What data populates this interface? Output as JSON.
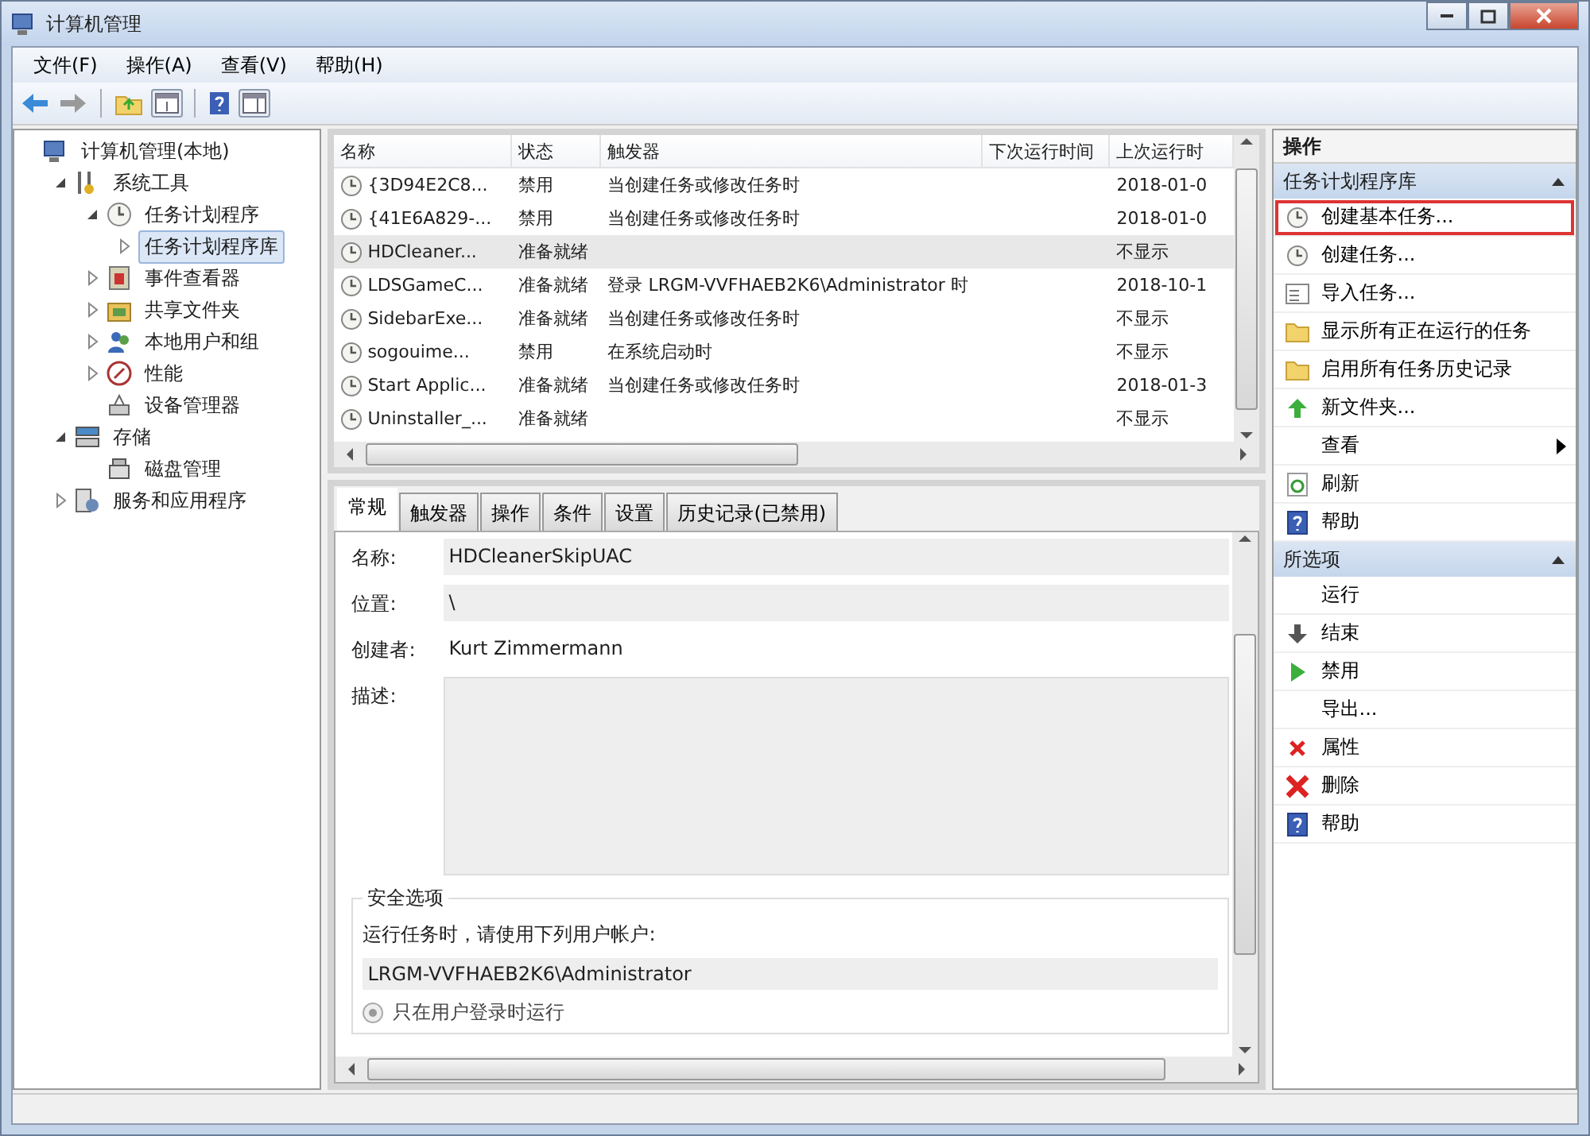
{
  "window": {
    "title": "计算机管理"
  },
  "menu": [
    {
      "label": "文件(F)"
    },
    {
      "label": "操作(A)"
    },
    {
      "label": "查看(V)"
    },
    {
      "label": "帮助(H)"
    }
  ],
  "tree": [
    {
      "label": "计算机管理(本地)",
      "selected": false,
      "children": [
        {
          "label": "系统工具",
          "expanded": true,
          "selected": false,
          "children": [
            {
              "label": "任务计划程序",
              "expanded": true,
              "selected": false,
              "children": [
                {
                  "label": "任务计划程序库",
                  "expanded": false,
                  "selected": true
                }
              ]
            },
            {
              "label": "事件查看器",
              "expanded": false,
              "selected": false
            },
            {
              "label": "共享文件夹",
              "expanded": false,
              "selected": false
            },
            {
              "label": "本地用户和组",
              "expanded": false,
              "selected": false
            },
            {
              "label": "性能",
              "expanded": false,
              "selected": false
            },
            {
              "label": "设备管理器",
              "selected": false
            }
          ]
        },
        {
          "label": "存储",
          "expanded": true,
          "selected": false,
          "children": [
            {
              "label": "磁盘管理",
              "selected": false
            }
          ]
        },
        {
          "label": "服务和应用程序",
          "expanded": false,
          "selected": false
        }
      ]
    }
  ],
  "table": {
    "columns": [
      "名称",
      "状态",
      "触发器",
      "下次运行时间",
      "上次运行时"
    ],
    "rows": [
      {
        "cells": [
          "{3D94E2C8...",
          "禁用",
          "当创建任务或修改任务时",
          "",
          "2018-01-0"
        ],
        "selected": false
      },
      {
        "cells": [
          "{41E6A829-...",
          "禁用",
          "当创建任务或修改任务时",
          "",
          "2018-01-0"
        ],
        "selected": false
      },
      {
        "cells": [
          "HDCleaner...",
          "准备就绪",
          "",
          "",
          "不显示"
        ],
        "selected": true
      },
      {
        "cells": [
          "LDSGameC...",
          "准备就绪",
          "登录 LRGM-VVFHAEB2K6\\Administrator 时",
          "",
          "2018-10-1"
        ],
        "selected": false
      },
      {
        "cells": [
          "SidebarExe...",
          "准备就绪",
          "当创建任务或修改任务时",
          "",
          "不显示"
        ],
        "selected": false
      },
      {
        "cells": [
          "sogouime...",
          "禁用",
          "在系统启动时",
          "",
          "不显示"
        ],
        "selected": false
      },
      {
        "cells": [
          "Start Applic...",
          "准备就绪",
          "当创建任务或修改任务时",
          "",
          "2018-01-3"
        ],
        "selected": false
      },
      {
        "cells": [
          "Uninstaller_...",
          "准备就绪",
          "",
          "",
          "不显示"
        ],
        "selected": false
      }
    ]
  },
  "tabs": [
    {
      "label": "常规",
      "selected": true
    },
    {
      "label": "触发器",
      "selected": false
    },
    {
      "label": "操作",
      "selected": false
    },
    {
      "label": "条件",
      "selected": false
    },
    {
      "label": "设置",
      "selected": false
    },
    {
      "label": "历史记录(已禁用)",
      "selected": false
    }
  ],
  "details": [
    {
      "label": "名称:",
      "value": "HDCleanerSkipUAC",
      "kind": "boxed"
    },
    {
      "label": "位置:",
      "value": "\\",
      "kind": "boxed"
    },
    {
      "label": "创建者:",
      "value": "Kurt Zimmermann",
      "kind": "plain"
    },
    {
      "label": "描述:",
      "kind": "area"
    }
  ],
  "security": {
    "title": "安全选项",
    "prompt": "运行任务时，请使用下列用户帐户:",
    "account": "LRGM-VVFHAEB2K6\\Administrator",
    "options": [
      {
        "label": "只在用户登录时运行",
        "selected": true,
        "disabled": true
      }
    ]
  },
  "actions": {
    "title": "操作",
    "sections": [
      {
        "title": "任务计划程序库",
        "expanded": true,
        "items": [
          {
            "label": "创建基本任务...",
            "highlighted": true
          },
          {
            "label": "创建任务...",
            "highlighted": false
          },
          {
            "label": "导入任务...",
            "highlighted": false
          },
          {
            "label": "显示所有正在运行的任务",
            "highlighted": false
          },
          {
            "label": "启用所有任务历史记录",
            "highlighted": false
          },
          {
            "label": "新文件夹...",
            "highlighted": false
          },
          {
            "label": "查看",
            "highlighted": false,
            "submenu": true
          },
          {
            "label": "刷新",
            "highlighted": false
          },
          {
            "label": "帮助",
            "highlighted": false
          }
        ]
      },
      {
        "title": "所选项",
        "expanded": true,
        "items": [
          {
            "label": "运行",
            "highlighted": false
          },
          {
            "label": "结束",
            "highlighted": false
          },
          {
            "label": "禁用",
            "highlighted": false
          },
          {
            "label": "导出...",
            "highlighted": false
          },
          {
            "label": "属性",
            "highlighted": false
          },
          {
            "label": "删除",
            "highlighted": false
          },
          {
            "label": "帮助",
            "highlighted": false
          }
        ]
      }
    ]
  }
}
